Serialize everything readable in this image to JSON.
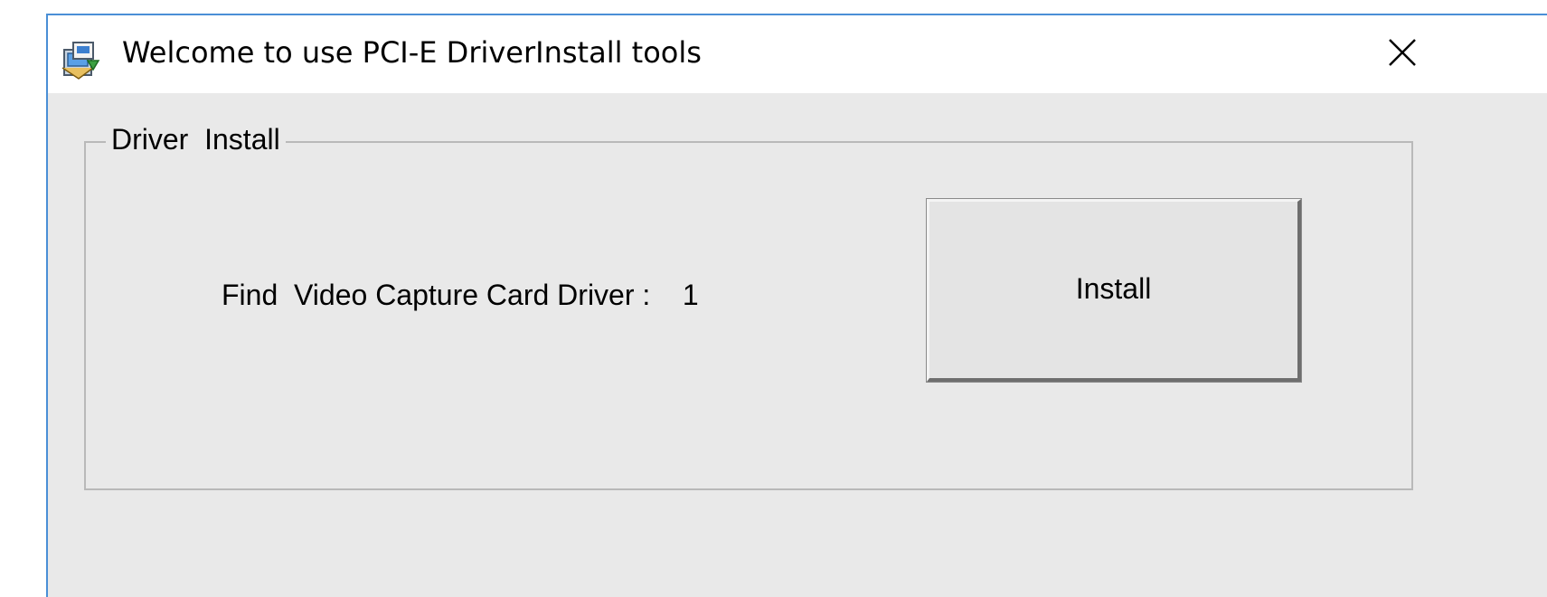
{
  "window": {
    "title": "Welcome to use PCI-E DriverInstall tools",
    "icon": "installer-icon",
    "close_icon": "close-icon"
  },
  "group": {
    "legend": "Driver  Install",
    "find_label": "Find  Video Capture Card Driver :    1",
    "install_button": "Install"
  },
  "colors": {
    "window_border": "#4a8fd6",
    "background": "#e9e9e9",
    "titlebar": "#ffffff"
  }
}
